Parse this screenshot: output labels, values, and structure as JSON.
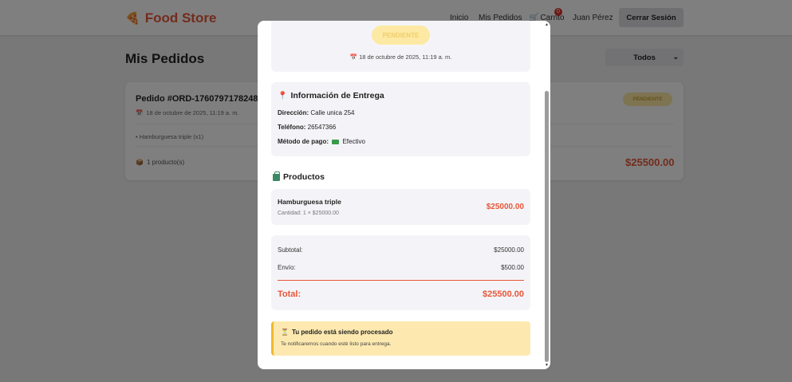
{
  "header": {
    "brand": "Food Store",
    "brand_icon": "pizza-icon",
    "nav": {
      "inicio": "Inicio",
      "pedidos": "Mis Pedidos",
      "cart": "Carrito",
      "cart_count": "0",
      "user": "Juan Pérez"
    },
    "logout_label": "Cerrar Sesión"
  },
  "page": {
    "title": "Mis Pedidos",
    "filter": {
      "selected": "Todos"
    }
  },
  "order_card": {
    "title": "Pedido #ORD-1760797178248",
    "date": "18 de octubre de 2025, 11:19 a. m.",
    "item": "• Hamburguesa triple (x1)",
    "count": "1 producto(s)",
    "status": "PENDIENTE",
    "total": "$25500.00"
  },
  "modal": {
    "status": "PENDIENTE",
    "date": "18 de octubre de 2025, 11:19 a. m.",
    "delivery": {
      "title": "Información de Entrega",
      "address_label": "Dirección:",
      "address": "Calle unica 254",
      "phone_label": "Teléfono:",
      "phone": "26547366",
      "payment_label": "Método de pago:",
      "payment": "Efectivo"
    },
    "products_title": "Productos",
    "products": [
      {
        "name": "Hamburguesa triple",
        "qty": "Cantidad: 1 × $25000.00",
        "price": "$25000.00"
      }
    ],
    "summary": {
      "subtotal_label": "Subtotal:",
      "subtotal": "$25000.00",
      "shipping_label": "Envío:",
      "shipping": "$500.00",
      "total_label": "Total:",
      "total": "$25500.00"
    },
    "notice": {
      "title": "Tu pedido está siendo procesado",
      "text": "Te notificaremos cuando esté listo para entrega."
    }
  },
  "colors": {
    "accent": "#e8573a",
    "pending_bg": "#fde9a3",
    "notice_bg": "#fde9b0"
  }
}
